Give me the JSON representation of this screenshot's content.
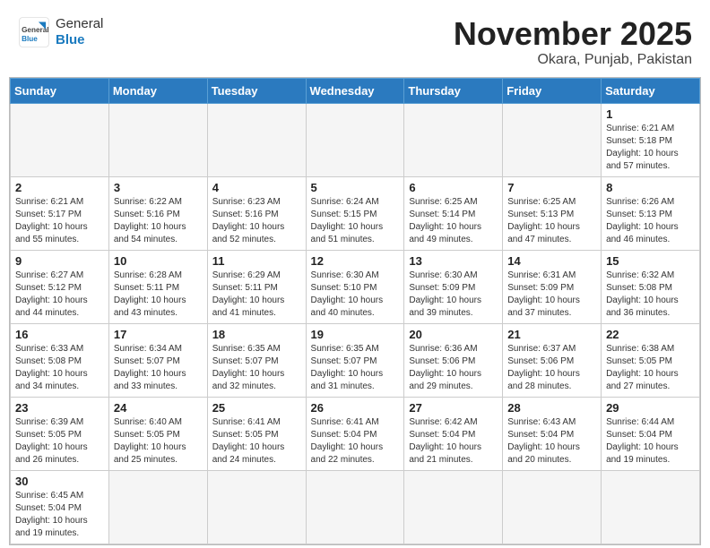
{
  "header": {
    "logo_general": "General",
    "logo_blue": "Blue",
    "month": "November 2025",
    "location": "Okara, Punjab, Pakistan"
  },
  "weekdays": [
    "Sunday",
    "Monday",
    "Tuesday",
    "Wednesday",
    "Thursday",
    "Friday",
    "Saturday"
  ],
  "weeks": [
    [
      {
        "day": "",
        "info": ""
      },
      {
        "day": "",
        "info": ""
      },
      {
        "day": "",
        "info": ""
      },
      {
        "day": "",
        "info": ""
      },
      {
        "day": "",
        "info": ""
      },
      {
        "day": "",
        "info": ""
      },
      {
        "day": "1",
        "info": "Sunrise: 6:21 AM\nSunset: 5:18 PM\nDaylight: 10 hours\nand 57 minutes."
      }
    ],
    [
      {
        "day": "2",
        "info": "Sunrise: 6:21 AM\nSunset: 5:17 PM\nDaylight: 10 hours\nand 55 minutes."
      },
      {
        "day": "3",
        "info": "Sunrise: 6:22 AM\nSunset: 5:16 PM\nDaylight: 10 hours\nand 54 minutes."
      },
      {
        "day": "4",
        "info": "Sunrise: 6:23 AM\nSunset: 5:16 PM\nDaylight: 10 hours\nand 52 minutes."
      },
      {
        "day": "5",
        "info": "Sunrise: 6:24 AM\nSunset: 5:15 PM\nDaylight: 10 hours\nand 51 minutes."
      },
      {
        "day": "6",
        "info": "Sunrise: 6:25 AM\nSunset: 5:14 PM\nDaylight: 10 hours\nand 49 minutes."
      },
      {
        "day": "7",
        "info": "Sunrise: 6:25 AM\nSunset: 5:13 PM\nDaylight: 10 hours\nand 47 minutes."
      },
      {
        "day": "8",
        "info": "Sunrise: 6:26 AM\nSunset: 5:13 PM\nDaylight: 10 hours\nand 46 minutes."
      }
    ],
    [
      {
        "day": "9",
        "info": "Sunrise: 6:27 AM\nSunset: 5:12 PM\nDaylight: 10 hours\nand 44 minutes."
      },
      {
        "day": "10",
        "info": "Sunrise: 6:28 AM\nSunset: 5:11 PM\nDaylight: 10 hours\nand 43 minutes."
      },
      {
        "day": "11",
        "info": "Sunrise: 6:29 AM\nSunset: 5:11 PM\nDaylight: 10 hours\nand 41 minutes."
      },
      {
        "day": "12",
        "info": "Sunrise: 6:30 AM\nSunset: 5:10 PM\nDaylight: 10 hours\nand 40 minutes."
      },
      {
        "day": "13",
        "info": "Sunrise: 6:30 AM\nSunset: 5:09 PM\nDaylight: 10 hours\nand 39 minutes."
      },
      {
        "day": "14",
        "info": "Sunrise: 6:31 AM\nSunset: 5:09 PM\nDaylight: 10 hours\nand 37 minutes."
      },
      {
        "day": "15",
        "info": "Sunrise: 6:32 AM\nSunset: 5:08 PM\nDaylight: 10 hours\nand 36 minutes."
      }
    ],
    [
      {
        "day": "16",
        "info": "Sunrise: 6:33 AM\nSunset: 5:08 PM\nDaylight: 10 hours\nand 34 minutes."
      },
      {
        "day": "17",
        "info": "Sunrise: 6:34 AM\nSunset: 5:07 PM\nDaylight: 10 hours\nand 33 minutes."
      },
      {
        "day": "18",
        "info": "Sunrise: 6:35 AM\nSunset: 5:07 PM\nDaylight: 10 hours\nand 32 minutes."
      },
      {
        "day": "19",
        "info": "Sunrise: 6:35 AM\nSunset: 5:07 PM\nDaylight: 10 hours\nand 31 minutes."
      },
      {
        "day": "20",
        "info": "Sunrise: 6:36 AM\nSunset: 5:06 PM\nDaylight: 10 hours\nand 29 minutes."
      },
      {
        "day": "21",
        "info": "Sunrise: 6:37 AM\nSunset: 5:06 PM\nDaylight: 10 hours\nand 28 minutes."
      },
      {
        "day": "22",
        "info": "Sunrise: 6:38 AM\nSunset: 5:05 PM\nDaylight: 10 hours\nand 27 minutes."
      }
    ],
    [
      {
        "day": "23",
        "info": "Sunrise: 6:39 AM\nSunset: 5:05 PM\nDaylight: 10 hours\nand 26 minutes."
      },
      {
        "day": "24",
        "info": "Sunrise: 6:40 AM\nSunset: 5:05 PM\nDaylight: 10 hours\nand 25 minutes."
      },
      {
        "day": "25",
        "info": "Sunrise: 6:41 AM\nSunset: 5:05 PM\nDaylight: 10 hours\nand 24 minutes."
      },
      {
        "day": "26",
        "info": "Sunrise: 6:41 AM\nSunset: 5:04 PM\nDaylight: 10 hours\nand 22 minutes."
      },
      {
        "day": "27",
        "info": "Sunrise: 6:42 AM\nSunset: 5:04 PM\nDaylight: 10 hours\nand 21 minutes."
      },
      {
        "day": "28",
        "info": "Sunrise: 6:43 AM\nSunset: 5:04 PM\nDaylight: 10 hours\nand 20 minutes."
      },
      {
        "day": "29",
        "info": "Sunrise: 6:44 AM\nSunset: 5:04 PM\nDaylight: 10 hours\nand 19 minutes."
      }
    ],
    [
      {
        "day": "30",
        "info": "Sunrise: 6:45 AM\nSunset: 5:04 PM\nDaylight: 10 hours\nand 19 minutes."
      },
      {
        "day": "",
        "info": ""
      },
      {
        "day": "",
        "info": ""
      },
      {
        "day": "",
        "info": ""
      },
      {
        "day": "",
        "info": ""
      },
      {
        "day": "",
        "info": ""
      },
      {
        "day": "",
        "info": ""
      }
    ]
  ]
}
